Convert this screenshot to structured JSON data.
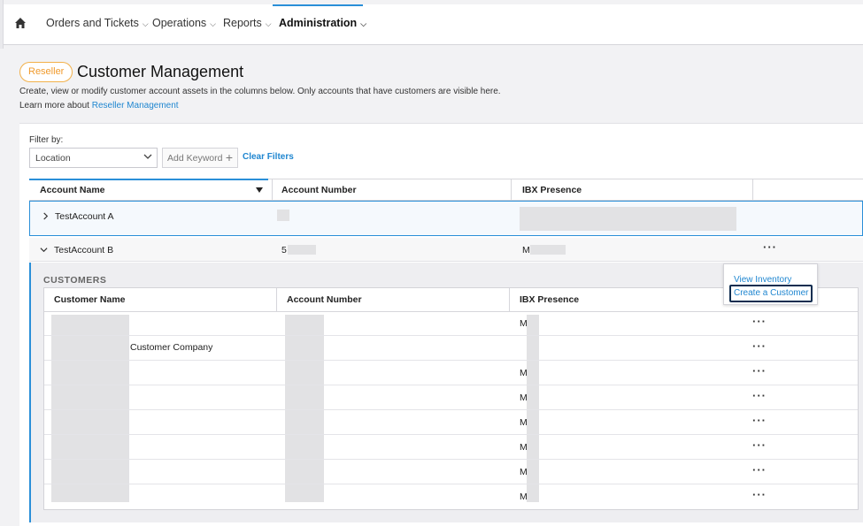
{
  "nav": {
    "items": [
      {
        "label": "Orders and Tickets"
      },
      {
        "label": "Operations"
      },
      {
        "label": "Reports"
      },
      {
        "label": "Administration"
      }
    ]
  },
  "header": {
    "badge": "Reseller",
    "title": "Customer Management",
    "description": "Create, view or modify customer account assets in the columns below. Only accounts that have customers are visible here.",
    "learn_prefix": "Learn more about ",
    "learn_link": "Reseller Management"
  },
  "filters": {
    "label": "Filter by:",
    "location_value": "Location",
    "add_keyword_placeholder": "Add Keyword",
    "clear_label": "Clear Filters"
  },
  "accounts_table": {
    "columns": [
      "Account Name",
      "Account Number",
      "IBX Presence"
    ],
    "rows": [
      {
        "name": "TestAccount A",
        "number": "",
        "ibx": ""
      },
      {
        "name": "TestAccount B",
        "number": "5",
        "ibx": "M"
      }
    ]
  },
  "row_menu": {
    "ellipsis": "···",
    "view_inventory": "View Inventory",
    "create_customer": "Create a Customer"
  },
  "customers": {
    "section_label": "CUSTOMERS",
    "columns": [
      "Customer Name",
      "Account Number",
      "IBX Presence"
    ],
    "rows": [
      {
        "name": "",
        "ibx": "M"
      },
      {
        "name": "Customer Company",
        "ibx": ""
      },
      {
        "name": "",
        "ibx": "M"
      },
      {
        "name": "",
        "ibx": "M"
      },
      {
        "name": "",
        "ibx": "M"
      },
      {
        "name": "",
        "ibx": "M"
      },
      {
        "name": "",
        "ibx": "M"
      },
      {
        "name": "",
        "ibx": "M"
      }
    ]
  },
  "colors": {
    "accent": "#2a8fd8",
    "link": "#1f86d0",
    "badge": "#f09a2c"
  }
}
